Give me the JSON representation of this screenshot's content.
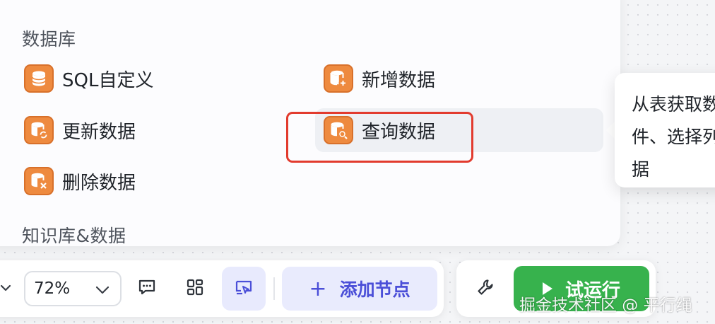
{
  "panel": {
    "section_database": "数据库",
    "section_knowledge": "知识库&数据",
    "items": [
      {
        "label": "SQL自定义",
        "icon": "database-icon"
      },
      {
        "label": "新增数据",
        "icon": "database-add-icon"
      },
      {
        "label": "更新数据",
        "icon": "database-refresh-icon"
      },
      {
        "label": "查询数据",
        "icon": "database-search-icon"
      },
      {
        "label": "删除数据",
        "icon": "database-delete-icon"
      }
    ],
    "icon_color": "#ee8a3f",
    "highlight_color": "#e23b2e"
  },
  "tooltip": {
    "line1": "从表获取数",
    "line2": "件、选择列",
    "line3": "据"
  },
  "toolbar": {
    "zoom": "72%",
    "add_node_label": "添加节点",
    "add_node_plus": "+",
    "run_label": "试运行",
    "run_color": "#37b24d",
    "accent": "#4b4fd8"
  },
  "watermark": "掘金技术社区 @ 平行绳"
}
